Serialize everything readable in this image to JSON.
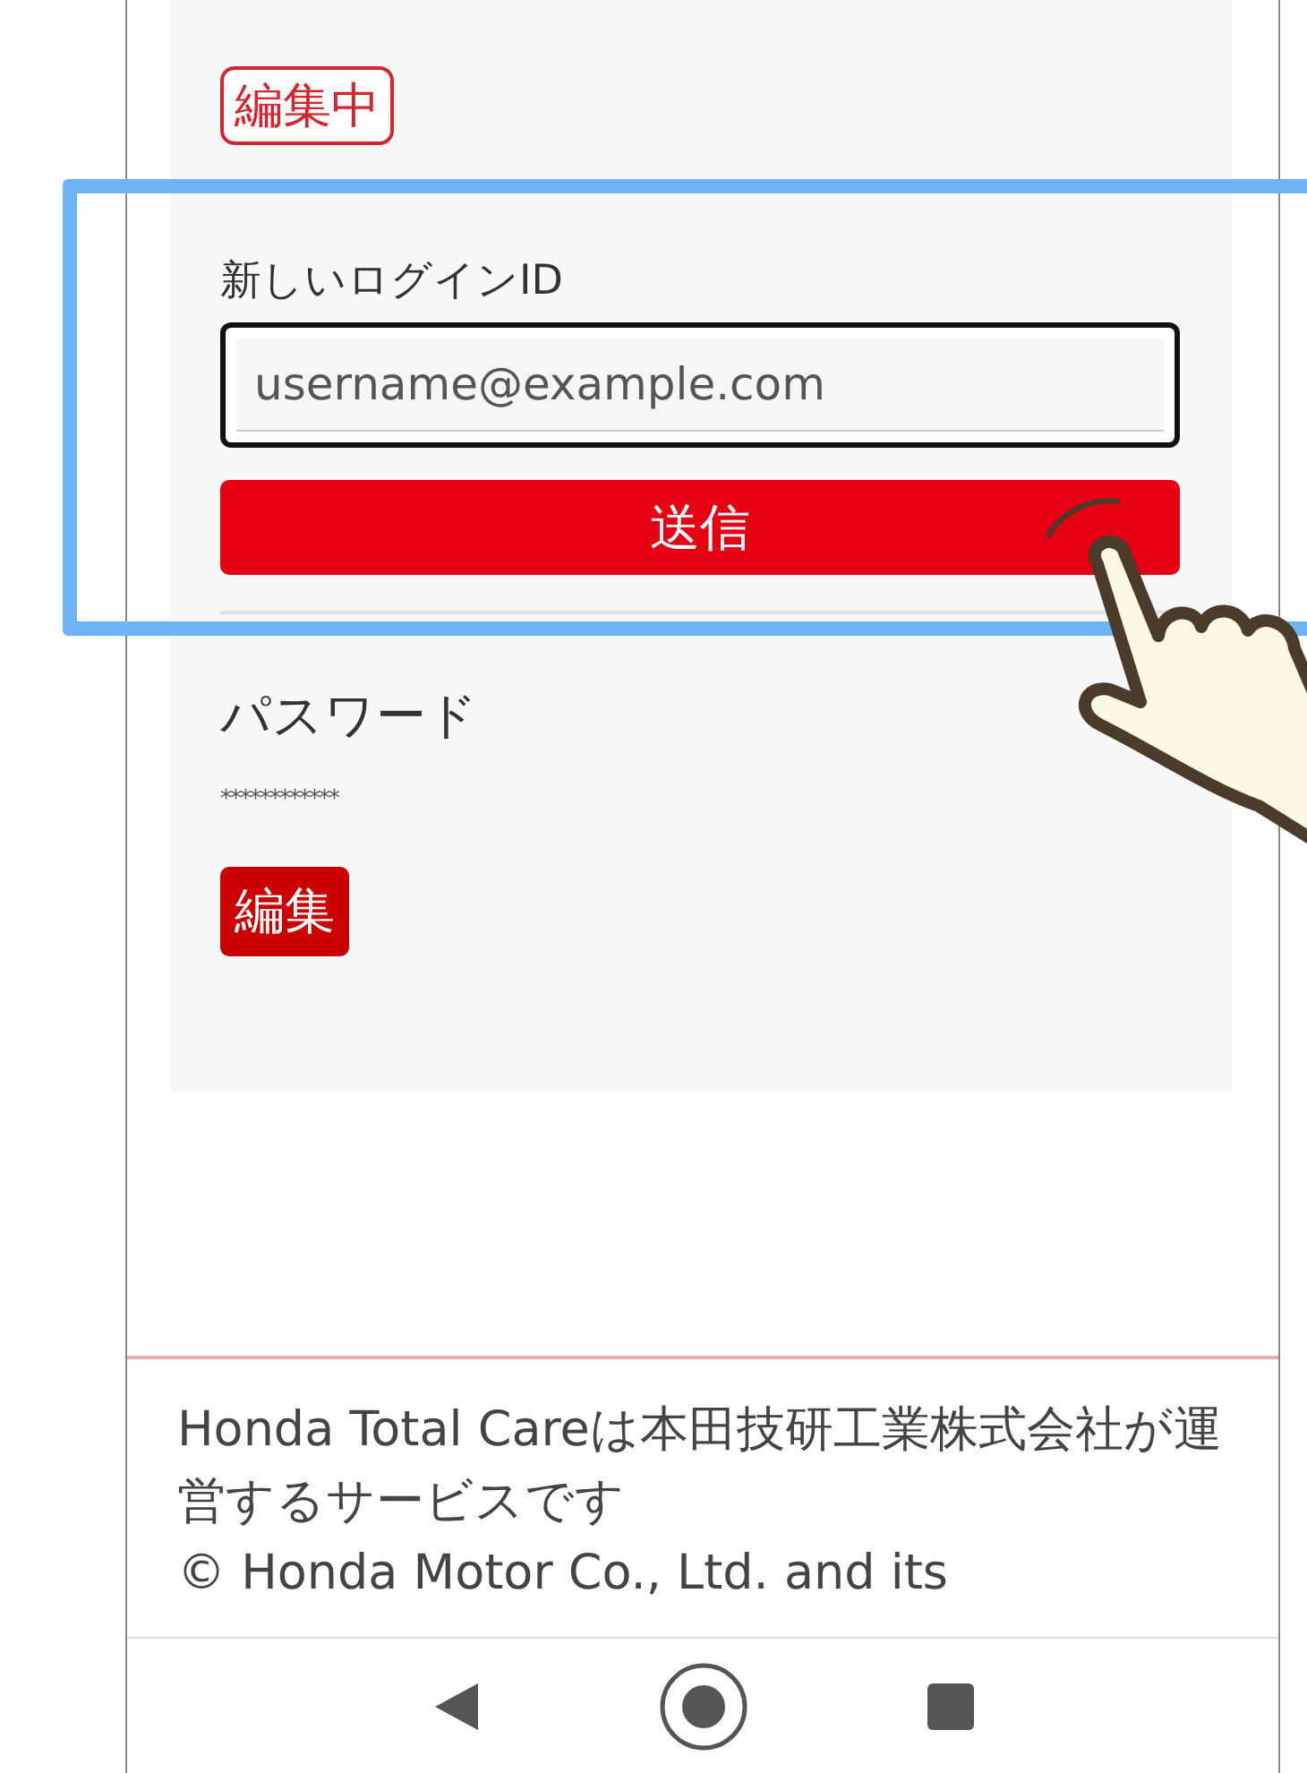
{
  "login_id": {
    "status_badge": "編集中",
    "label": "新しいログインID",
    "input": {
      "placeholder": "username@example.com"
    },
    "submit_button": "送信"
  },
  "password": {
    "label": "パスワード",
    "masked_value": "************",
    "edit_button": "編集"
  },
  "footer": {
    "notice": "Honda Total Careは本田技研工業株式会社が運営するサービスです",
    "copyright": "© Honda Motor Co., Ltd. and its"
  },
  "nav_bar": [
    {
      "kind": "back"
    },
    {
      "kind": "home"
    },
    {
      "kind": "recents"
    }
  ]
}
